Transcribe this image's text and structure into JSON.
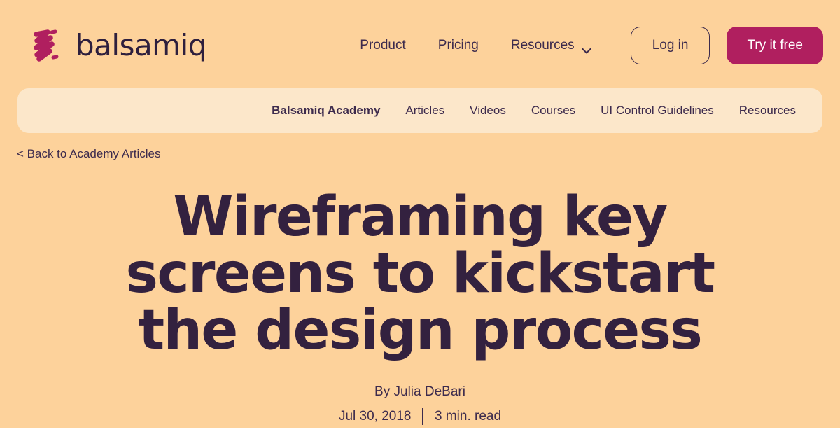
{
  "colors": {
    "hero_background": "#fdd29b",
    "subnav_background": "#fce7ca",
    "brand_magenta": "#b01f5f",
    "text_dark_purple": "#33213f",
    "page_background": "#ffffff"
  },
  "header": {
    "brand_name": "balsamiq",
    "brand_mark_icon": "balsamiq-scribble-logo-icon",
    "nav": [
      {
        "label": "Product",
        "has_dropdown": false
      },
      {
        "label": "Pricing",
        "has_dropdown": false
      },
      {
        "label": "Resources",
        "has_dropdown": true,
        "dropdown_icon": "chevron-down-icon"
      }
    ],
    "login_label": "Log in",
    "try_label": "Try it free"
  },
  "subnav": {
    "items": [
      {
        "label": "Balsamiq Academy",
        "primary": true
      },
      {
        "label": "Articles",
        "primary": false
      },
      {
        "label": "Videos",
        "primary": false
      },
      {
        "label": "Courses",
        "primary": false
      },
      {
        "label": "UI Control Guidelines",
        "primary": false
      },
      {
        "label": "Resources",
        "primary": false
      }
    ]
  },
  "breadcrumb": {
    "back_label": "< Back to Academy Articles"
  },
  "article": {
    "title": "Wireframing key screens to kickstart the design process",
    "byline": "By Julia DeBari",
    "date": "Jul 30, 2018",
    "read_time": "3 min. read"
  }
}
